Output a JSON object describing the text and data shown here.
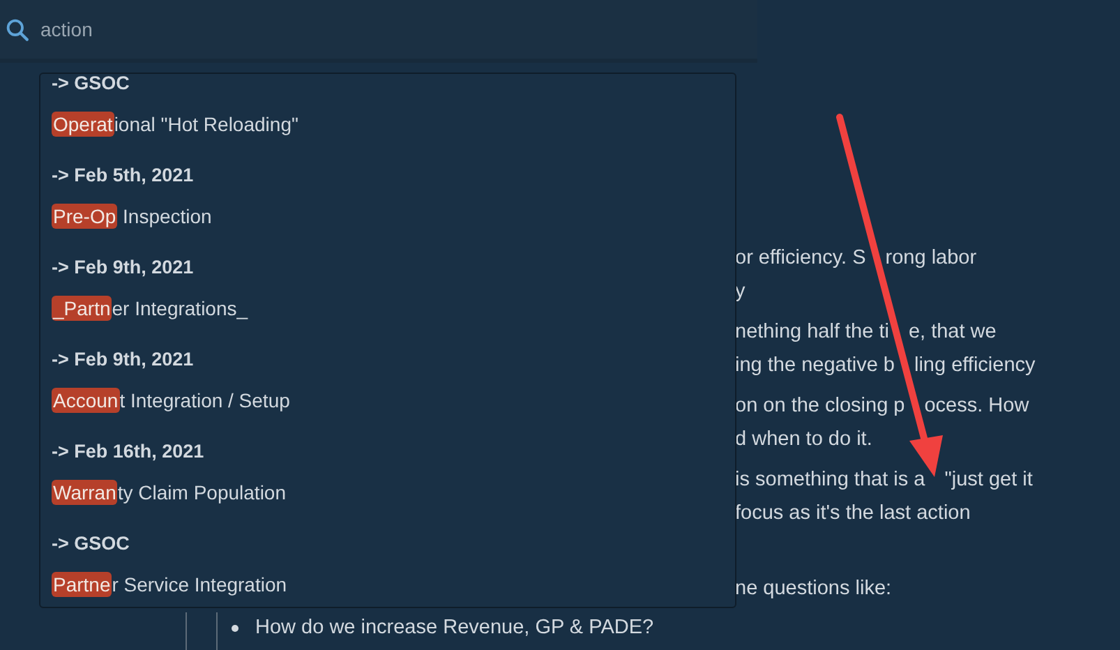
{
  "search": {
    "value": "action"
  },
  "results": [
    {
      "heading": "-> GSOC",
      "match": "Operat",
      "rest": "ional \"Hot Reloading\""
    },
    {
      "heading": "-> Feb 5th, 2021",
      "match": "Pre-Op",
      "rest": " Inspection"
    },
    {
      "heading": "-> Feb 9th, 2021",
      "match": "_Partn",
      "rest": "er Integrations_"
    },
    {
      "heading": "-> Feb 9th, 2021",
      "match": "Accoun",
      "rest": "t Integration / Setup"
    },
    {
      "heading": "-> Feb 16th, 2021",
      "match": "Warran",
      "rest": "ty Claim Population"
    },
    {
      "heading": "-> GSOC",
      "match": "Partne",
      "rest": "r Service Integration"
    }
  ],
  "document": {
    "paragraphs": [
      {
        "lines": [
          [
            "or efficiency. S",
            "rong labor"
          ],
          [
            "y"
          ]
        ]
      },
      {
        "lines": [
          [
            "nething half the ti",
            "e, that we"
          ],
          [
            "ing the negative b",
            "ling efficiency"
          ]
        ]
      },
      {
        "lines": [
          [
            "on on the closing p",
            "ocess. How"
          ],
          [
            "d when to do it."
          ]
        ]
      },
      {
        "lines": [
          [
            "is something that is a",
            "\"just get it"
          ],
          [
            "focus as it's the last action"
          ]
        ]
      },
      {
        "lines": [
          [
            "ne questions like:"
          ]
        ]
      }
    ],
    "bullets": [
      "How do we increase Revenue, GP & PADE?"
    ]
  }
}
